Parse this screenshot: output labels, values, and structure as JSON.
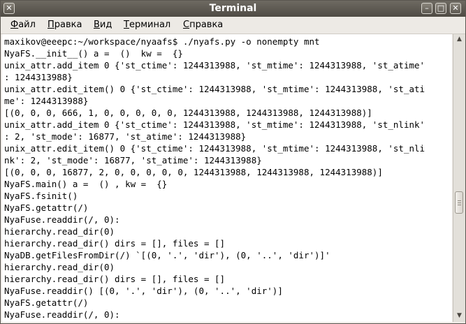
{
  "window": {
    "title": "Terminal"
  },
  "titlebar_buttons": [
    {
      "name": "close-window-button",
      "glyph": "✕"
    },
    {
      "name": "minimize-window-button",
      "glyph": "–"
    },
    {
      "name": "maximize-window-button",
      "glyph": "□"
    },
    {
      "name": "close-button",
      "glyph": "✕"
    }
  ],
  "menu": [
    {
      "label": "Файл",
      "underline": "Ф",
      "rest": "айл"
    },
    {
      "label": "Правка",
      "underline": "П",
      "rest": "равка"
    },
    {
      "label": "Вид",
      "underline": "В",
      "rest": "ид"
    },
    {
      "label": "Терминал",
      "underline": "Т",
      "rest": "ерминал"
    },
    {
      "label": "Справка",
      "underline": "С",
      "rest": "правка"
    }
  ],
  "terminal": {
    "lines": [
      "maxikov@eeepc:~/workspace/nyaafs$ ./nyafs.py -o nonempty mnt",
      "NyaFS.__init__() a =  ()  kw =  {}",
      "unix_attr.add_item 0 {'st_ctime': 1244313988, 'st_mtime': 1244313988, 'st_atime'",
      ": 1244313988}",
      "unix_attr.edit_item() 0 {'st_ctime': 1244313988, 'st_mtime': 1244313988, 'st_ati",
      "me': 1244313988}",
      "[(0, 0, 0, 666, 1, 0, 0, 0, 0, 0, 1244313988, 1244313988, 1244313988)]",
      "unix_attr.add_item 0 {'st_ctime': 1244313988, 'st_mtime': 1244313988, 'st_nlink'",
      ": 2, 'st_mode': 16877, 'st_atime': 1244313988}",
      "unix_attr.edit_item() 0 {'st_ctime': 1244313988, 'st_mtime': 1244313988, 'st_nli",
      "nk': 2, 'st_mode': 16877, 'st_atime': 1244313988}",
      "[(0, 0, 0, 16877, 2, 0, 0, 0, 0, 0, 1244313988, 1244313988, 1244313988)]",
      "NyaFS.main() a =  () , kw =  {}",
      "NyaFS.fsinit()",
      "NyaFS.getattr(/)",
      "NyaFuse.readdir(/, 0):",
      "hierarchy.read_dir(0)",
      "hierarchy.read_dir() dirs = [], files = []",
      "NyaDB.getFilesFromDir(/) `[(0, '.', 'dir'), (0, '..', 'dir')]'",
      "hierarchy.read_dir(0)",
      "hierarchy.read_dir() dirs = [], files = []",
      "NyaFuse.readdir() [(0, '.', 'dir'), (0, '..', 'dir')]",
      "NyaFS.getattr(/)",
      "NyaFuse.readdir(/, 0):"
    ]
  },
  "scrollbar": {
    "up_glyph": "▲",
    "down_glyph": "▼",
    "position": 0.6
  }
}
